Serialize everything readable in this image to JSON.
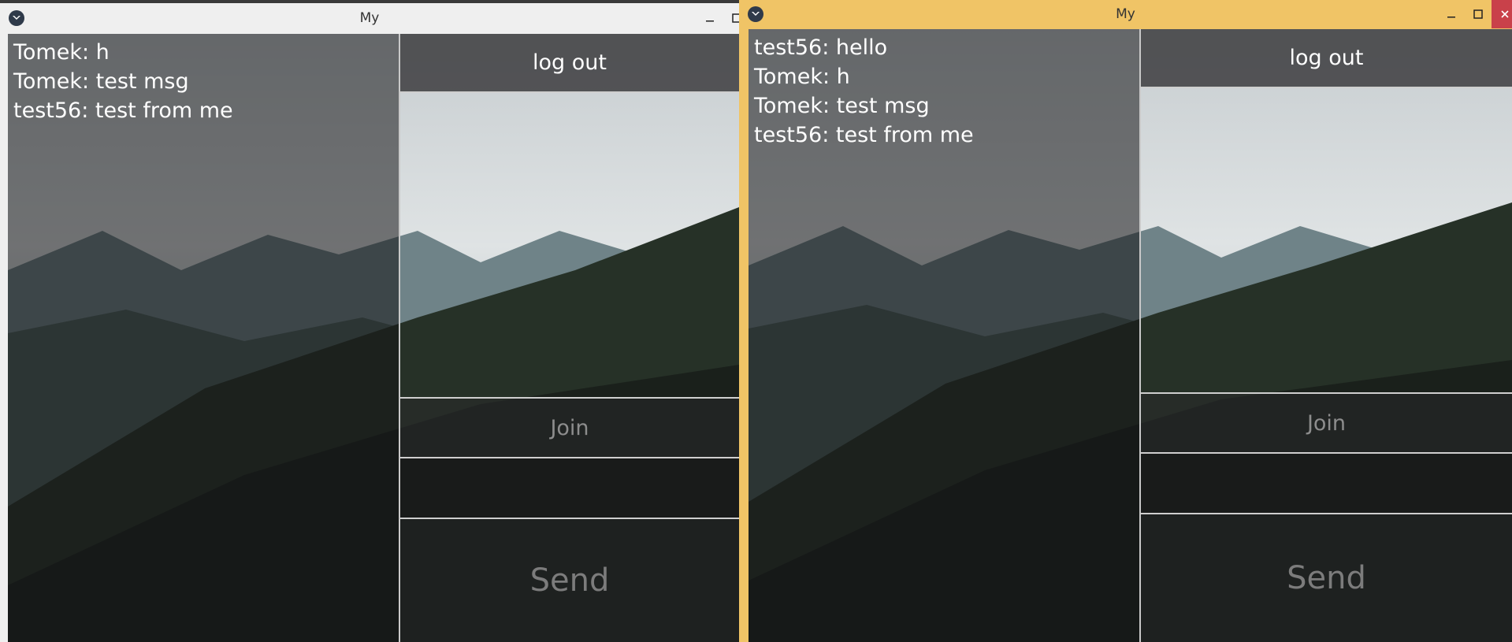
{
  "windows": [
    {
      "title": "My",
      "messages": [
        "Tomek: h",
        "Tomek: test msg",
        "test56: test from me"
      ],
      "logout_label": "log out",
      "join_label": "Join",
      "message_input": {
        "value": "",
        "placeholder": ""
      },
      "send_label": "Send"
    },
    {
      "title": "My",
      "messages": [
        "test56: hello",
        "Tomek: h",
        "Tomek: test msg",
        "test56: test from me"
      ],
      "logout_label": "log out",
      "join_label": "Join",
      "message_input": {
        "value": "",
        "placeholder": ""
      },
      "send_label": "Send"
    }
  ],
  "colors": {
    "active_title_bar": "#f0c466",
    "inactive_title_bar": "#efefef",
    "close_button": "#c9414a",
    "divider": "#cfcfcf"
  },
  "icons": {
    "app": "kivy-logo-icon",
    "minimize": "minimize-icon",
    "maximize": "maximize-icon",
    "close": "close-icon"
  }
}
